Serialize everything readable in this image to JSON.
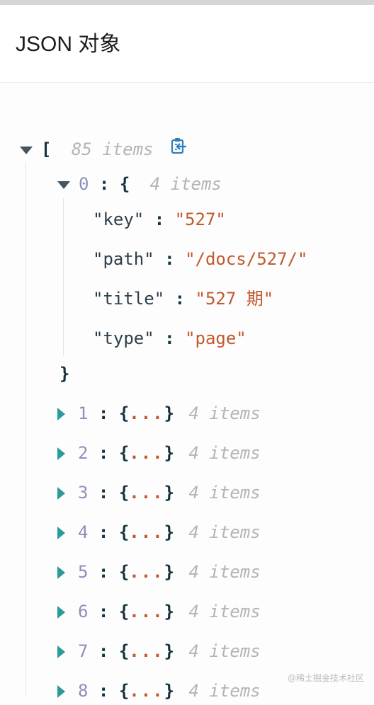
{
  "header": {
    "title": "JSON 对象"
  },
  "viewer": {
    "root": {
      "open_bracket": "[",
      "count_label": "85 items",
      "copy_icon": "copy-to-clipboard-icon"
    },
    "expanded_item": {
      "index": "0",
      "colon": ":",
      "open_brace": "{",
      "count_label": "4 items",
      "close_brace": "}",
      "fields": [
        {
          "key": "\"key\"",
          "sep": ":",
          "value": "\"527\""
        },
        {
          "key": "\"path\"",
          "sep": ":",
          "value": "\"/docs/527/\""
        },
        {
          "key": "\"title\"",
          "sep": ":",
          "value": "\"527 期\""
        },
        {
          "key": "\"type\"",
          "sep": ":",
          "value": "\"page\""
        }
      ]
    },
    "collapsed_items": [
      {
        "index": "1",
        "colon": ":",
        "open_brace": "{",
        "ellipsis": "...",
        "close_brace": "}",
        "count_label": "4 items"
      },
      {
        "index": "2",
        "colon": ":",
        "open_brace": "{",
        "ellipsis": "...",
        "close_brace": "}",
        "count_label": "4 items"
      },
      {
        "index": "3",
        "colon": ":",
        "open_brace": "{",
        "ellipsis": "...",
        "close_brace": "}",
        "count_label": "4 items"
      },
      {
        "index": "4",
        "colon": ":",
        "open_brace": "{",
        "ellipsis": "...",
        "close_brace": "}",
        "count_label": "4 items"
      },
      {
        "index": "5",
        "colon": ":",
        "open_brace": "{",
        "ellipsis": "...",
        "close_brace": "}",
        "count_label": "4 items"
      },
      {
        "index": "6",
        "colon": ":",
        "open_brace": "{",
        "ellipsis": "...",
        "close_brace": "}",
        "count_label": "4 items"
      },
      {
        "index": "7",
        "colon": ":",
        "open_brace": "{",
        "ellipsis": "...",
        "close_brace": "}",
        "count_label": "4 items"
      },
      {
        "index": "8",
        "colon": ":",
        "open_brace": "{",
        "ellipsis": "...",
        "close_brace": "}",
        "count_label": "4 items"
      }
    ]
  },
  "watermark": "@稀土掘金技术社区",
  "colors": {
    "key": "#2b3e4a",
    "string_value": "#c1592d",
    "index": "#8c8fb8",
    "meta": "#b4b4b4",
    "caret_expand": "#2c9a9a",
    "caret_collapse": "#45545e",
    "copy_icon": "#2f7fbf"
  }
}
